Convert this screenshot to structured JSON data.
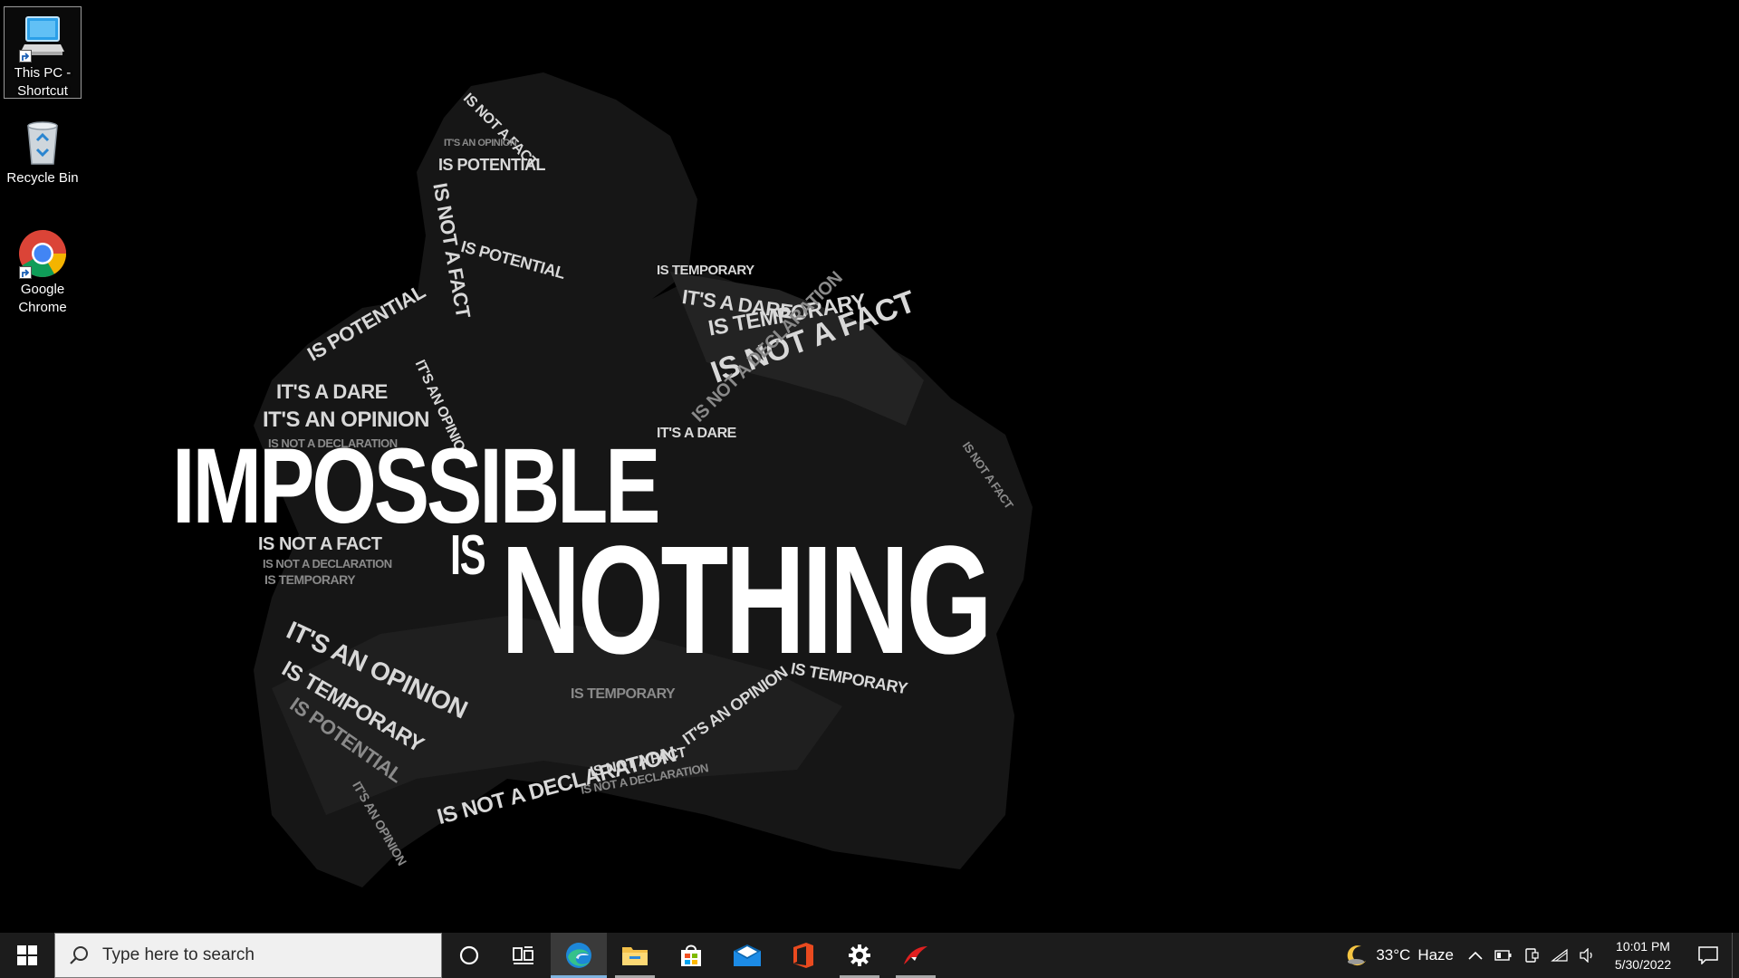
{
  "desktop": {
    "icons": [
      {
        "label": "This PC - Shortcut",
        "icon": "this-pc-icon"
      },
      {
        "label": "Recycle Bin",
        "icon": "recycle-bin-icon"
      },
      {
        "label": "Google Chrome",
        "icon": "chrome-icon"
      }
    ]
  },
  "wallpaper": {
    "headline_line1": "IMPOSSIBLE",
    "headline_is": "IS",
    "headline_line2": "NOTHING",
    "phrases": [
      "IS NOT A FACT",
      "IT'S AN OPINION",
      "IS POTENTIAL",
      "IT'S A DARE",
      "IS TEMPORARY",
      "IS NOT A DECLARATION"
    ]
  },
  "taskbar": {
    "search_placeholder": "Type here to search",
    "apps": [
      {
        "name": "Microsoft Edge",
        "icon": "edge-icon",
        "active": true
      },
      {
        "name": "File Explorer",
        "icon": "file-explorer-icon",
        "active": false
      },
      {
        "name": "Microsoft Store",
        "icon": "store-icon",
        "active": false
      },
      {
        "name": "Mail",
        "icon": "mail-icon",
        "active": false
      },
      {
        "name": "Office",
        "icon": "office-icon",
        "active": false
      },
      {
        "name": "Settings",
        "icon": "settings-icon",
        "active": false
      },
      {
        "name": "App",
        "icon": "app-icon",
        "active": false
      }
    ],
    "weather": {
      "temp": "33°C",
      "condition": "Haze",
      "icon": "moon-icon"
    },
    "clock": {
      "time": "10:01 PM",
      "date": "5/30/2022"
    }
  },
  "colors": {
    "taskbar_bg": "#1c1c1c",
    "accent": "#7fb3e0",
    "desktop_bg": "#000000"
  }
}
